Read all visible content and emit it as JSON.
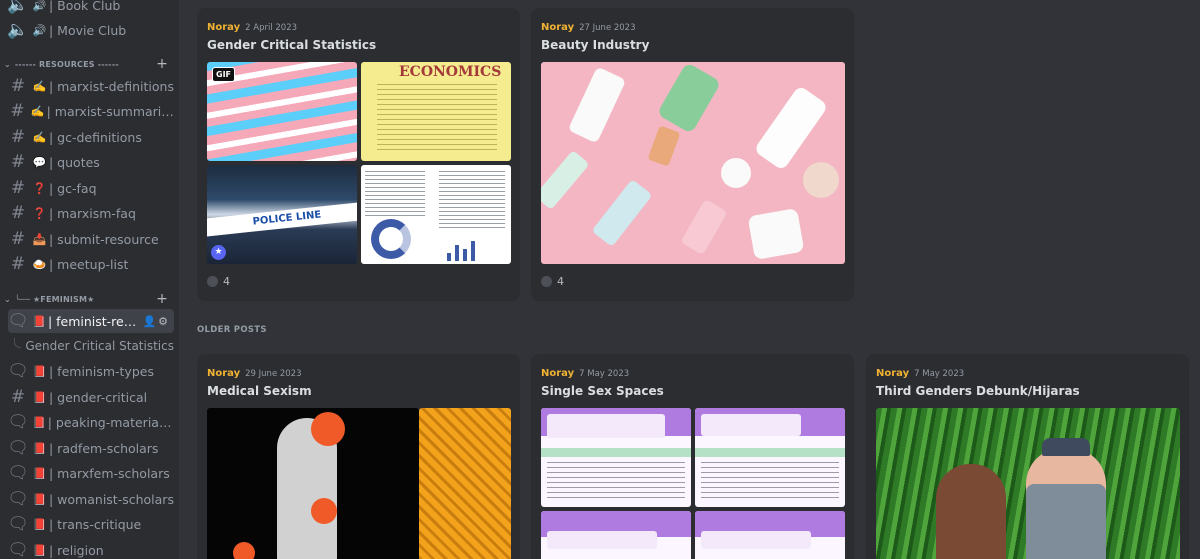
{
  "sidebar": {
    "top_channels": [
      {
        "emoji": "🔊",
        "label": "| Book Club"
      },
      {
        "emoji": "🔊",
        "label": "| Movie Club"
      }
    ],
    "resources_category": {
      "label": "------ RESOURCES ------",
      "add": "+"
    },
    "resources_channels": [
      {
        "emoji": "✍️",
        "label": "| marxist-definitions"
      },
      {
        "emoji": "✍️",
        "label": "| marxist-summarized"
      },
      {
        "emoji": "✍️",
        "label": "| gc-definitions"
      },
      {
        "emoji": "💬",
        "label": "| quotes"
      },
      {
        "emoji": "❓",
        "label": "| gc-faq"
      },
      {
        "emoji": "❓",
        "label": "| marxism-faq"
      },
      {
        "emoji": "📥",
        "label": "| submit-resource"
      },
      {
        "emoji": "🍛",
        "label": "| meetup-list"
      }
    ],
    "feminism_category": {
      "label": "╰── ★FEMINISM★",
      "add": "+"
    },
    "feminism_channels": [
      {
        "emoji": "📕",
        "label": "| feminist-reso...",
        "active": true
      },
      {
        "emoji": "📕",
        "label": "| feminism-types"
      },
      {
        "emoji": "📕",
        "label": "| gender-critical"
      },
      {
        "emoji": "📕",
        "label": "| peaking-material-n..."
      },
      {
        "emoji": "📕",
        "label": "| radfem-scholars"
      },
      {
        "emoji": "📕",
        "label": "| marxfem-scholars"
      },
      {
        "emoji": "📕",
        "label": "| womanist-scholars"
      },
      {
        "emoji": "📕",
        "label": "| trans-critique"
      },
      {
        "emoji": "📕",
        "label": "| religion"
      }
    ],
    "active_thread": "Gender Critical Statistics"
  },
  "posts_pinned": [
    {
      "author": "Noray",
      "date": "2 April 2023",
      "title": "Gender Critical Statistics",
      "replies": "4",
      "gif_badge": "GIF",
      "image_text": "ECONOMICS"
    },
    {
      "author": "Noray",
      "date": "27 June 2023",
      "title": "Beauty Industry",
      "replies": "4"
    }
  ],
  "older_label": "OLDER POSTS",
  "posts_older": [
    {
      "author": "Noray",
      "date": "29 June 2023",
      "title": "Medical Sexism"
    },
    {
      "author": "Noray",
      "date": "7 May 2023",
      "title": "Single Sex Spaces"
    },
    {
      "author": "Noray",
      "date": "7 May 2023",
      "title": "Third Genders Debunk/Hijaras"
    }
  ],
  "colors": {
    "accent_author": "#f0b232",
    "bg": "#313338",
    "sidebar": "#2b2d31",
    "card": "#2b2d31"
  }
}
